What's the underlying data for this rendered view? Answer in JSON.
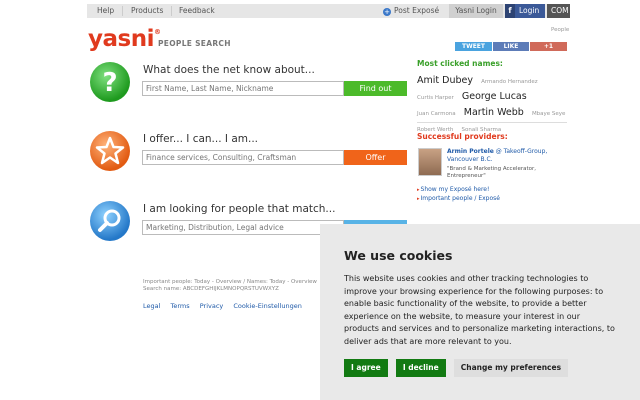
{
  "topnav": {
    "help": "Help",
    "products": "Products",
    "feedback": "Feedback",
    "post_expose": "Post Exposé",
    "yasni_login": "Yasni Login",
    "fb_login": "Login",
    "com": "COM"
  },
  "header": {
    "logo": "yasni",
    "logo_mark": "®",
    "tagline": "PEOPLE SEARCH",
    "people_label": "People"
  },
  "social": {
    "tweet": "TWEET",
    "like": "LIKE",
    "gplus": "+1"
  },
  "search_rows": [
    {
      "title": "What does the net know about...",
      "placeholder": "First Name, Last Name, Nickname",
      "button": "Find out",
      "icon": "question-icon"
    },
    {
      "title": "I offer... I can... I am...",
      "placeholder": "Finance services, Consulting, Craftsman",
      "button": "Offer",
      "icon": "star-icon"
    },
    {
      "title": "I am looking for people that match...",
      "placeholder": "Marketing, Distribution, Legal advice",
      "button": "",
      "icon": "magnifier-icon"
    }
  ],
  "important": {
    "line1": "Important people: Today - Overview / Names: Today - Overview",
    "line2": "Search name: ABCDEFGHIJKLMNOPQRSTUVWXYZ"
  },
  "footer": {
    "legal": "Legal",
    "terms": "Terms",
    "privacy": "Privacy",
    "cookie": "Cookie-Einstellungen"
  },
  "right": {
    "most_title": "Most clicked names:",
    "names": {
      "amit": "Amit Dubey",
      "armando": "Armando Hernandez",
      "curtis": "Curtis Harper",
      "george": "George Lucas",
      "juan": "Juan Carmona",
      "martin": "Martin Webb",
      "mbaye": "Mbaye Seye",
      "robert": "Robert Werth",
      "sonali": "Sonali Sharma"
    },
    "prov_title": "Successful providers:",
    "provider_name": "Armin Portele",
    "provider_company": "@ Takeoff-Group, Vancouver B.C.",
    "provider_desc": "\"Brand & Marketing Accelerator, Entrepreneur\"",
    "link_show": "Show my Exposé here!",
    "link_important": "Important people / Exposé"
  },
  "cookie": {
    "title": "We use cookies",
    "text": "This website uses cookies and other tracking technologies to improve your browsing experience for the following purposes: to enable basic functionality of the website, to provide a better experience on the website, to measure your interest in our products and services and to personalize marketing interactions, to deliver ads that are more relevant to you.",
    "agree": "I agree",
    "decline": "I decline",
    "prefs": "Change my preferences"
  },
  "colors": {
    "brand": "#e03a1e",
    "green": "#4cba2a",
    "orange": "#f0641a",
    "blue": "#58b3e6",
    "cookie_button": "#127a12"
  }
}
